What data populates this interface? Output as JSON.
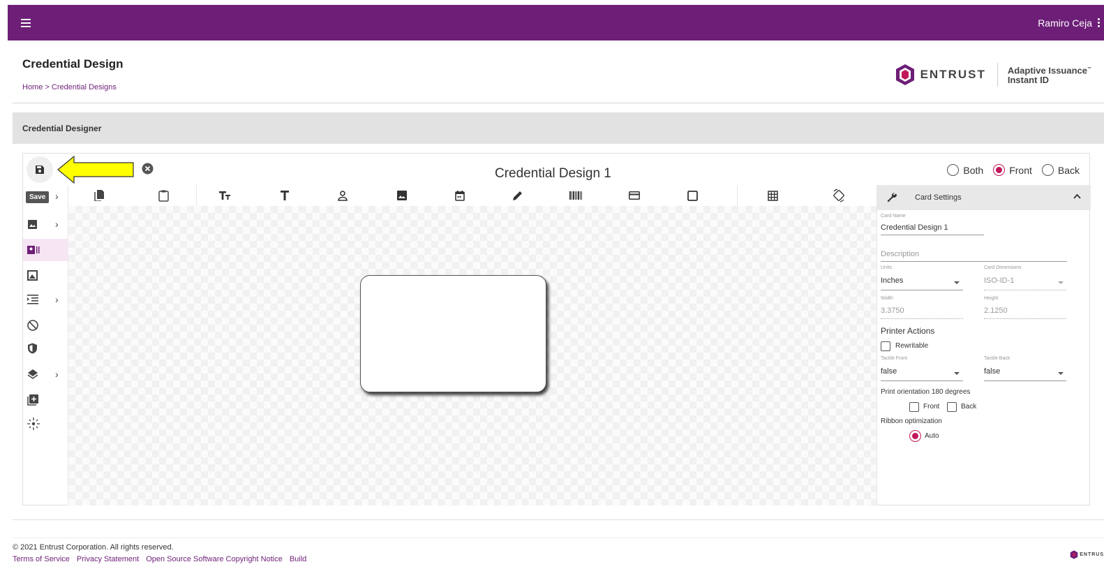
{
  "app": {
    "user_name": "Ramiro Ceja",
    "brand_colors": {
      "primary": "#6d1f77",
      "accent": "#c2185b"
    }
  },
  "header": {
    "title": "Credential Design",
    "breadcrumb": "Home > Credential Designs",
    "brand_word": "ENTRUST",
    "product_line1": "Adaptive Issuance",
    "product_tm": "™",
    "product_line2": "Instant ID"
  },
  "section": {
    "title": "Credential Designer"
  },
  "designer": {
    "design_title": "Credential Design 1",
    "save_tooltip": "Save",
    "sides": [
      {
        "label": "Both",
        "selected": false
      },
      {
        "label": "Front",
        "selected": true
      },
      {
        "label": "Back",
        "selected": false
      }
    ],
    "toolbar_icons": [
      "copy-icon",
      "paste-icon",
      "text-size-icon",
      "text-icon",
      "person-icon",
      "image-icon",
      "calendar-icon",
      "pencil-icon",
      "barcode-icon",
      "magstripe-icon",
      "rectangle-icon",
      "grid-icon",
      "rotate-icon"
    ],
    "left_icons": [
      "image-icon",
      "id-card-icon",
      "photo-frame-icon",
      "indent-icon",
      "block-icon",
      "shield-icon",
      "layers-icon",
      "add-box-icon",
      "sparkle-icon"
    ]
  },
  "settings": {
    "title": "Card Settings",
    "card_name_label": "Card Name",
    "card_name": "Credential Design 1",
    "description_placeholder": "Description",
    "units_label": "Units",
    "units": "Inches",
    "dimensions_label": "Card Dimensions",
    "dimensions": "ISO-ID-1",
    "width_label": "Width",
    "width": "3.3750",
    "height_label": "Height",
    "height": "2.1250",
    "printer_actions": "Printer Actions",
    "rewritable": "Rewritable",
    "tactile_front_label": "Tactile Front",
    "tactile_front": "false",
    "tactile_back_label": "Tactile Back",
    "tactile_back": "false",
    "print_orientation": "Print orientation 180 degrees",
    "front": "Front",
    "back": "Back",
    "ribbon_optimization": "Ribbon optimization",
    "auto": "Auto"
  },
  "footer": {
    "copyright": "© 2021 Entrust Corporation. All rights reserved.",
    "links": [
      "Terms of Service",
      "Privacy Statement",
      "Open Source Software Copyright Notice",
      "Build"
    ],
    "logo_word": "ENTRUS"
  }
}
